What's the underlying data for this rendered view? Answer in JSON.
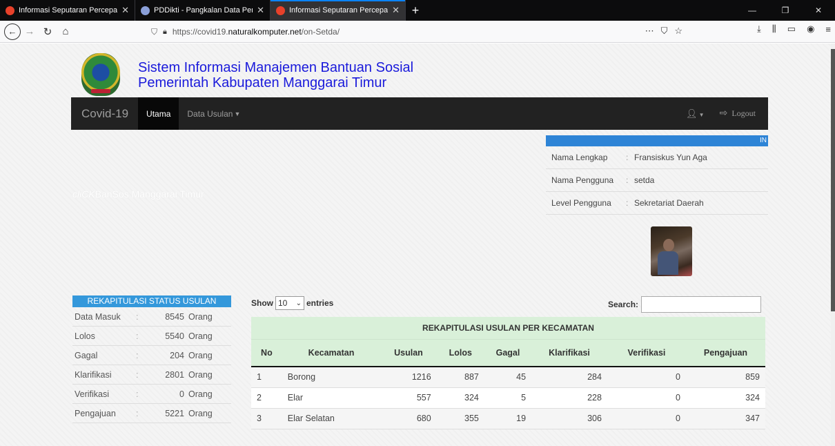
{
  "browser": {
    "tabs": [
      {
        "title": "Informasi Seputaran Percepatan",
        "active": false,
        "favicon_color": "#e8412a"
      },
      {
        "title": "PDDikti - Pangkalan Data Pendidikan",
        "active": false,
        "favicon_color": "#8a9fd8"
      },
      {
        "title": "Informasi Seputaran Percepatan",
        "active": true,
        "favicon_color": "#e8412a"
      }
    ],
    "url_prefix": "https://covid19.",
    "url_domain": "naturalkomputer.net",
    "url_path": "/on-Setda/",
    "url_more": "⋯",
    "new_tab": "+"
  },
  "header": {
    "line1": "Sistem Informasi Manajemen Bantuan Sosial",
    "line2": "Pemerintah Kabupaten Manggarai Timur"
  },
  "nav": {
    "brand": "Covid-19",
    "items": [
      "Utama",
      "Data Usulan"
    ],
    "user_icon": "user-icon",
    "logout": "Logout"
  },
  "hero": {
    "prefix": "cliCK",
    "rest": "BanSos Manggarai Timur"
  },
  "info": {
    "bar_text": "IN",
    "rows": [
      {
        "label": "Nama Lengkap",
        "value": "Fransiskus Yun Aga"
      },
      {
        "label": "Nama Pengguna",
        "value": "setda"
      },
      {
        "label": "Level Pengguna",
        "value": "Sekretariat Daerah"
      }
    ]
  },
  "status": {
    "title": "REKAPITULASI STATUS USULAN",
    "rows": [
      {
        "label": "Data Masuk",
        "value": "8545",
        "unit": "Orang"
      },
      {
        "label": "Lolos",
        "value": "5540",
        "unit": "Orang"
      },
      {
        "label": "Gagal",
        "value": "204",
        "unit": "Orang"
      },
      {
        "label": "Klarifikasi",
        "value": "2801",
        "unit": "Orang"
      },
      {
        "label": "Verifikasi",
        "value": "0",
        "unit": "Orang"
      },
      {
        "label": "Pengajuan",
        "value": "5221",
        "unit": "Orang"
      }
    ]
  },
  "table": {
    "show_label": "Show",
    "entries_value": "10",
    "entries_label": "entries",
    "search_label": "Search:",
    "caption": "REKAPITULASI USULAN PER KECAMATAN",
    "headers": [
      "No",
      "Kecamatan",
      "Usulan",
      "Lolos",
      "Gagal",
      "Klarifikasi",
      "Verifikasi",
      "Pengajuan"
    ],
    "rows": [
      [
        "1",
        "Borong",
        "1216",
        "887",
        "45",
        "284",
        "0",
        "859"
      ],
      [
        "2",
        "Elar",
        "557",
        "324",
        "5",
        "228",
        "0",
        "324"
      ],
      [
        "3",
        "Elar Selatan",
        "680",
        "355",
        "19",
        "306",
        "0",
        "347"
      ]
    ]
  }
}
